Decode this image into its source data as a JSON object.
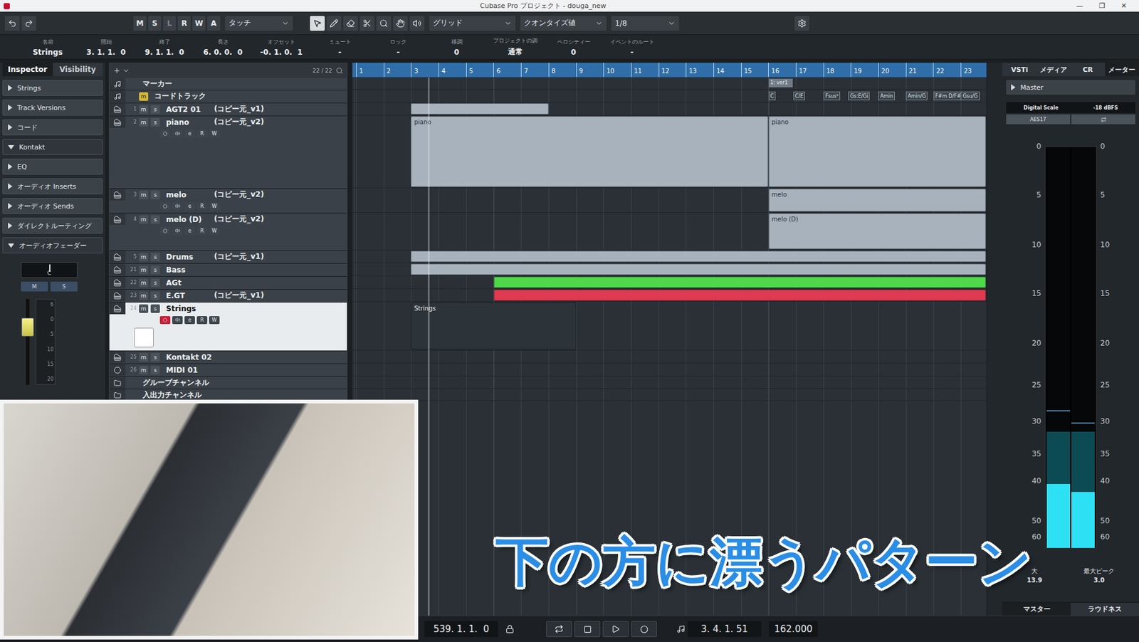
{
  "window": {
    "title": "Cubase Pro プロジェクト - douga_new",
    "controls": [
      "—",
      "❐",
      "✕"
    ]
  },
  "toolbar": {
    "modes": [
      "M",
      "S",
      "L",
      "R",
      "W",
      "A"
    ],
    "automation": "タッチ",
    "snap": "グリッド",
    "quantize_label": "クオンタイズ値",
    "quantize": "1/8"
  },
  "info_line": [
    {
      "label": "名前",
      "value": "Strings"
    },
    {
      "label": "開始",
      "value": "3. 1. 1.  0"
    },
    {
      "label": "終了",
      "value": "9. 1. 1.  0"
    },
    {
      "label": "長さ",
      "value": "6. 0. 0.  0"
    },
    {
      "label": "オフセット",
      "value": "-0. 1. 0.  1"
    },
    {
      "label": "ミュート",
      "value": "-"
    },
    {
      "label": "ロック",
      "value": "-"
    },
    {
      "label": "移調",
      "value": "0"
    },
    {
      "label": "プロジェクトの調",
      "value": "通常"
    },
    {
      "label": "ベロシティー",
      "value": "0"
    },
    {
      "label": "イベントのルート",
      "value": "-"
    }
  ],
  "inspector": {
    "tabs": [
      {
        "label": "Inspector",
        "selected": true
      },
      {
        "label": "Visibility",
        "selected": false
      }
    ],
    "sections": [
      {
        "label": "Strings",
        "expanded": false
      },
      {
        "label": "Track Versions",
        "expanded": false
      },
      {
        "label": "コード",
        "expanded": false
      },
      {
        "label": "Kontakt",
        "expanded": true
      },
      {
        "label": "EQ",
        "expanded": false
      },
      {
        "label": "オーディオ Inserts",
        "expanded": false
      },
      {
        "label": "オーディオ Sends",
        "expanded": false
      },
      {
        "label": "ダイレクトルーティング",
        "expanded": false
      },
      {
        "label": "オーディオフェーダー",
        "expanded": true
      }
    ],
    "pan": "C",
    "buttons": [
      "M",
      "S"
    ],
    "fader": {
      "level": 0.72,
      "scale": [
        "6",
        "0",
        "5",
        "10",
        "15",
        "20"
      ]
    }
  },
  "track_list": {
    "count": "22 / 22",
    "buttons": [
      "m",
      "s"
    ],
    "expanded_buttons": [
      "e",
      "R",
      "W"
    ],
    "tracks": [
      {
        "num": "",
        "name": "マーカー",
        "comment": "",
        "kind": "marker",
        "expanded": false,
        "selected": false,
        "record": false,
        "parts": []
      },
      {
        "num": "",
        "name": "コードトラック",
        "comment": "",
        "kind": "chord",
        "expanded": false,
        "selected": false,
        "record": false,
        "parts": []
      },
      {
        "num": "1",
        "name": "AGT2 01",
        "comment": "(コピー元_v1)",
        "kind": "track",
        "expanded": false,
        "selected": false,
        "record": false,
        "parts": [
          {
            "label": "",
            "start": 3,
            "end": 8,
            "color": "#a7b2bd"
          }
        ]
      },
      {
        "num": "2",
        "name": "piano",
        "comment": "(コピー元_v2)",
        "kind": "track",
        "expanded": true,
        "selected": false,
        "record": false,
        "parts": [
          {
            "label": "piano",
            "start": 3,
            "end": 16,
            "color": "#a7b2bd"
          },
          {
            "label": "piano",
            "start": 16,
            "end": 23.9,
            "color": "#a7b2bd"
          }
        ]
      },
      {
        "num": "3",
        "name": "melo",
        "comment": "(コピー元_v2)",
        "kind": "track",
        "expanded": true,
        "selected": false,
        "record": false,
        "parts": [
          {
            "label": "melo",
            "start": 16,
            "end": 23.9,
            "color": "#a7b2bd"
          }
        ]
      },
      {
        "num": "4",
        "name": "melo (D)",
        "comment": "(コピー元_v2)",
        "kind": "track",
        "expanded": true,
        "selected": false,
        "record": false,
        "parts": [
          {
            "label": "melo (D)",
            "start": 16,
            "end": 23.9,
            "color": "#a7b2bd"
          }
        ]
      },
      {
        "num": "5",
        "name": "Drums",
        "comment": "(コピー元_v1)",
        "kind": "track",
        "expanded": false,
        "selected": false,
        "record": false,
        "parts": [
          {
            "label": "",
            "start": 3,
            "end": 23.9,
            "color": "#a7b2bd"
          }
        ]
      },
      {
        "num": "21",
        "name": "Bass",
        "comment": "",
        "kind": "track",
        "expanded": false,
        "selected": false,
        "record": false,
        "parts": [
          {
            "label": "",
            "start": 3,
            "end": 23.9,
            "color": "#a7b2bd"
          }
        ]
      },
      {
        "num": "22",
        "name": "AGt",
        "comment": "",
        "kind": "track",
        "expanded": false,
        "selected": false,
        "record": false,
        "parts": [
          {
            "label": "",
            "start": 6,
            "end": 23.9,
            "color": "#4fd84a"
          }
        ]
      },
      {
        "num": "23",
        "name": "E.GT",
        "comment": "(コピー元_v1)",
        "kind": "track",
        "expanded": false,
        "selected": false,
        "record": false,
        "parts": [
          {
            "label": "",
            "start": 6,
            "end": 23.9,
            "color": "#e03a52"
          }
        ]
      },
      {
        "num": "24",
        "name": "Strings",
        "comment": "",
        "kind": "track",
        "expanded": true,
        "selected": true,
        "record": true,
        "parts": [
          {
            "label": "Strings",
            "start": 3,
            "end": 9,
            "color": "#2c3339"
          }
        ]
      },
      {
        "num": "25",
        "name": "Kontakt 02",
        "comment": "",
        "kind": "track",
        "expanded": false,
        "selected": false,
        "record": false,
        "parts": []
      },
      {
        "num": "26",
        "name": "MIDI 01",
        "comment": "",
        "kind": "midi",
        "expanded": false,
        "selected": false,
        "record": false,
        "parts": []
      },
      {
        "num": "",
        "name": "グループチャンネル",
        "comment": "",
        "kind": "folder",
        "expanded": false,
        "selected": false,
        "record": false,
        "parts": []
      },
      {
        "num": "",
        "name": "入出力チャンネル",
        "comment": "",
        "kind": "folder",
        "expanded": false,
        "selected": false,
        "record": false,
        "parts": []
      }
    ]
  },
  "ruler": {
    "bars": [
      "1",
      "2",
      "3",
      "4",
      "5",
      "6",
      "7",
      "8",
      "9",
      "10",
      "11",
      "12",
      "13",
      "14",
      "15",
      "16",
      "17",
      "18",
      "19",
      "20",
      "21",
      "22",
      "23"
    ]
  },
  "playhead": 3.65,
  "marker": {
    "label": "1: ver1",
    "bar": 16
  },
  "chords": [
    {
      "label": "C",
      "bar": 16
    },
    {
      "label": "C/E",
      "bar": 16.9
    },
    {
      "label": "Fsus²",
      "bar": 18
    },
    {
      "label": "Gs:E/Gi",
      "bar": 18.9
    },
    {
      "label": "Amin",
      "bar": 20
    },
    {
      "label": "Amin/G",
      "bar": 21
    },
    {
      "label": "F#m D/F#",
      "bar": 22
    },
    {
      "label": "Gsu/G",
      "bar": 23
    }
  ],
  "right_panel": {
    "tabs": [
      {
        "label": "VSTi",
        "selected": false
      },
      {
        "label": "メディア",
        "selected": false
      },
      {
        "label": "CR",
        "selected": false
      },
      {
        "label": "メーター",
        "selected": true
      }
    ],
    "master": "Master",
    "digital_scale": {
      "label": "Digital Scale",
      "value": "-18 dBFS"
    },
    "standard": "AES17",
    "scale": [
      "0",
      "5",
      "10",
      "15",
      "20",
      "25",
      "30",
      "35",
      "40",
      "50",
      "60"
    ],
    "channels": [
      {
        "level": 0.16,
        "hold": 0.29,
        "peak": 0.34
      },
      {
        "level": 0.14,
        "hold": 0.29,
        "peak": 0.31
      }
    ],
    "readouts": [
      {
        "label": "大",
        "value": "13.9"
      },
      {
        "label": "最大ピーク",
        "value": "3.0"
      }
    ],
    "bottom_tabs": [
      {
        "label": "マスター",
        "selected": true
      },
      {
        "label": "ラウドネス",
        "selected": false
      }
    ]
  },
  "transport": {
    "position": "539. 1. 1.  0",
    "position2": "3. 4. 1. 51",
    "tempo": "162.000"
  },
  "video": {
    "caption": "下の方に漂うパターン"
  }
}
